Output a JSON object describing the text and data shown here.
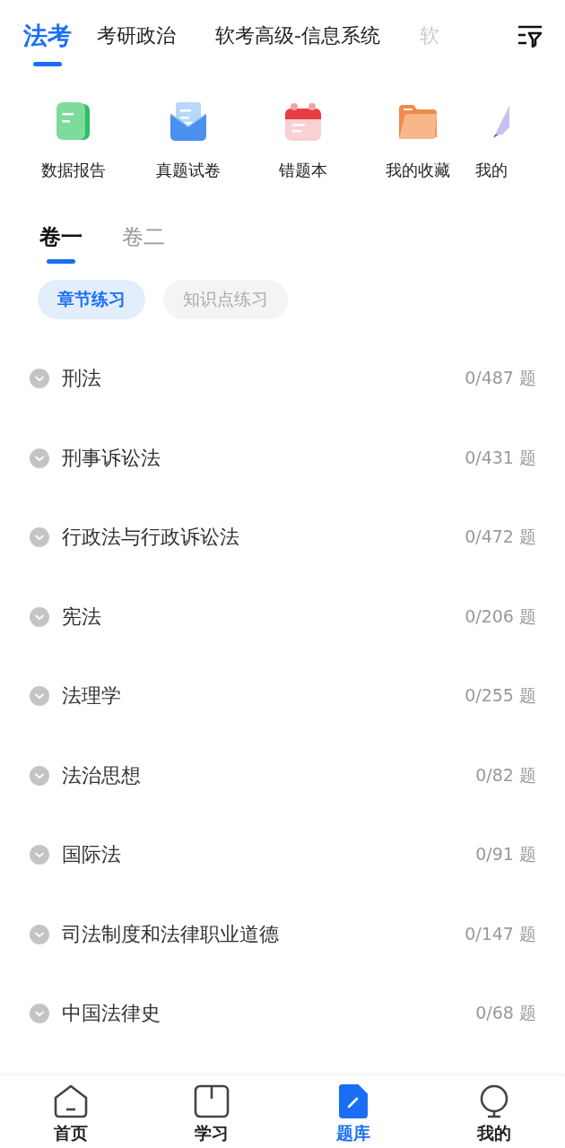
{
  "subject_tabs": [
    {
      "label": "法考",
      "selected": true
    },
    {
      "label": "考研政治",
      "selected": false
    },
    {
      "label": "软考高级-信息系统",
      "selected": false
    },
    {
      "label": "软",
      "selected": false,
      "faded": true
    }
  ],
  "shortcuts": [
    {
      "kind": "report",
      "label": "数据报告"
    },
    {
      "kind": "papers",
      "label": "真题试卷"
    },
    {
      "kind": "mistakes",
      "label": "错题本"
    },
    {
      "kind": "favorites",
      "label": "我的收藏"
    },
    {
      "kind": "notes",
      "label": "我的"
    }
  ],
  "paper_tabs": [
    {
      "label": "卷一",
      "selected": true
    },
    {
      "label": "卷二",
      "selected": false
    }
  ],
  "practice_chips": [
    {
      "label": "章节练习",
      "selected": true
    },
    {
      "label": "知识点练习",
      "selected": false
    }
  ],
  "chapters": [
    {
      "name": "刑法",
      "progress": "0/487 题"
    },
    {
      "name": "刑事诉讼法",
      "progress": "0/431 题"
    },
    {
      "name": "行政法与行政诉讼法",
      "progress": "0/472 题"
    },
    {
      "name": "宪法",
      "progress": "0/206 题"
    },
    {
      "name": "法理学",
      "progress": "0/255 题"
    },
    {
      "name": "法治思想",
      "progress": "0/82 题"
    },
    {
      "name": "国际法",
      "progress": "0/91 题"
    },
    {
      "name": "司法制度和法律职业道德",
      "progress": "0/147 题"
    },
    {
      "name": "中国法律史",
      "progress": "0/68 题"
    }
  ],
  "bottom_nav": [
    {
      "kind": "home",
      "label": "首页",
      "selected": false
    },
    {
      "kind": "study",
      "label": "学习",
      "selected": false
    },
    {
      "kind": "bank",
      "label": "题库",
      "selected": true
    },
    {
      "kind": "me",
      "label": "我的",
      "selected": false
    }
  ]
}
